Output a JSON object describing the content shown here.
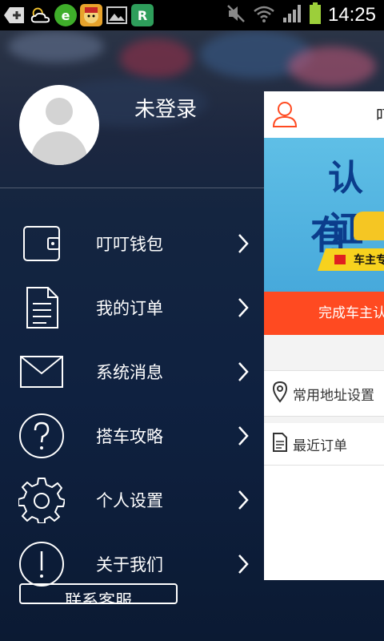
{
  "status_bar": {
    "time": "14:25",
    "icons": [
      "add-icon",
      "weather-icon",
      "browser-e-icon",
      "game-icon",
      "gallery-icon",
      "app-r-icon",
      "mute-icon",
      "wifi-icon",
      "signal-icon",
      "battery-icon"
    ]
  },
  "drawer": {
    "login_status": "未登录",
    "menu": [
      {
        "label": "叮叮钱包",
        "icon": "wallet-icon"
      },
      {
        "label": "我的订单",
        "icon": "document-icon"
      },
      {
        "label": "系统消息",
        "icon": "mail-icon"
      },
      {
        "label": "搭车攻略",
        "icon": "question-icon"
      },
      {
        "label": "个人设置",
        "icon": "gear-icon"
      },
      {
        "label": "关于我们",
        "icon": "info-exclamation-icon"
      }
    ],
    "contact_button": "联系客服"
  },
  "main_panel": {
    "title_fragment": "叮",
    "banner": {
      "line1": "认证",
      "line2": "有",
      "tape_text": "车主专享"
    },
    "cta_text": "完成车主认证",
    "rows": [
      {
        "label": "常用地址设置",
        "icon": "location-pin-icon"
      },
      {
        "label": "最近订单",
        "icon": "order-doc-icon"
      }
    ]
  },
  "colors": {
    "accent": "#ff4a21",
    "drawer_bg": "#0f2140"
  }
}
